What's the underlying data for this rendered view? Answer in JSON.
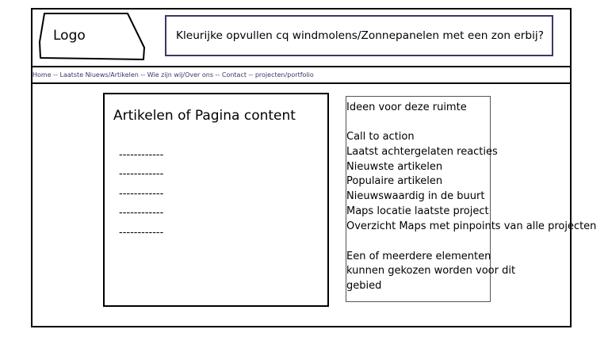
{
  "header": {
    "logo_label": "Logo",
    "banner_text": "Kleurijke opvullen cq windmolens/Zonnepanelen met een zon erbij?"
  },
  "nav": {
    "text": "Home -- Laatste Niuews/Artikelen -- Wie zijn wij/Over ons -- Contact -- projecten/portfolio"
  },
  "content": {
    "title": "Artikelen of Pagina content",
    "placeholders": [
      "------------",
      "------------",
      "------------",
      "------------",
      "------------"
    ]
  },
  "sidebar": {
    "heading": "Ideen voor deze ruimte",
    "items": [
      "Call to action",
      "Laatst achtergelaten reacties",
      "Nieuwste artikelen",
      "Populaire artikelen",
      "Nieuwswaardig in de buurt",
      "Maps locatie laatste project",
      "Overzicht Maps met pinpoints van alle projecten"
    ],
    "note_lines": [
      "Een of meerdere elementen",
      "kunnen gekozen worden voor dit",
      "gebied"
    ]
  },
  "colors": {
    "nav_text": "#37376b",
    "banner_border": "#38386a"
  }
}
